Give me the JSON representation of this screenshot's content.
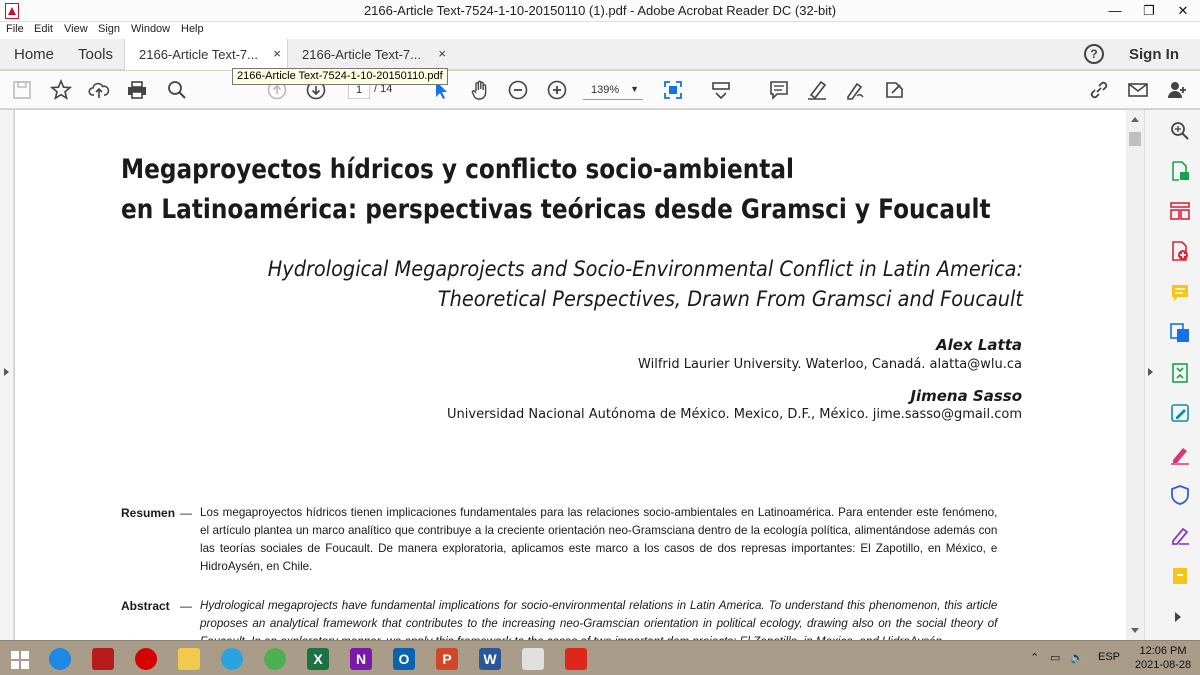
{
  "window": {
    "title": "2166-Article Text-7524-1-10-20150110 (1).pdf - Adobe Acrobat Reader DC (32-bit)",
    "minimize": "—",
    "restore": "❐",
    "close": "✕"
  },
  "menu": [
    "File",
    "Edit",
    "View",
    "Sign",
    "Window",
    "Help"
  ],
  "tabs": {
    "home": "Home",
    "tools": "Tools",
    "docs": [
      {
        "label": "2166-Article Text-7...",
        "close": "×"
      },
      {
        "label": "2166-Article Text-7...",
        "close": "×"
      }
    ],
    "help": "?",
    "sign_in": "Sign In"
  },
  "toolbar": {
    "tooltip": "2166-Article Text-7524-1-10-20150110.pdf",
    "page_current": "1",
    "page_total": "/ 14",
    "zoom": "139%",
    "icons": [
      "save-icon",
      "star-icon",
      "upload-icon",
      "print-icon",
      "search-icon",
      "prev-page-icon",
      "next-page-icon",
      "select-arrow-icon",
      "hand-icon",
      "zoom-out-icon",
      "zoom-in-icon",
      "fit-page-icon",
      "scroll-mode-icon",
      "comment-icon",
      "highlight-icon",
      "sign-icon",
      "share-icon",
      "link-icon",
      "email-icon",
      "add-user-icon"
    ]
  },
  "document": {
    "title_line1": "Megaproyectos hídricos y conflicto socio-ambiental",
    "title_line2": "en Latinoamérica: perspectivas teóricas desde Gramsci y Foucault",
    "subtitle_line1": "Hydrological Megaprojects and Socio-Environmental Conflict in Latin America:",
    "subtitle_line2": "Theoretical Perspectives, Drawn From Gramsci and Foucault",
    "author1": "Alex Latta",
    "affil1": "Wilfrid Laurier University. Waterloo, Canadá. alatta@wlu.ca",
    "author2": "Jimena Sasso",
    "affil2": "Universidad Nacional Autónoma de México. Mexico, D.F., México. jime.sasso@gmail.com",
    "resumen_label": "Resumen",
    "resumen_dash": "—",
    "resumen_text": "Los megaproyectos hídricos tienen implicaciones fundamentales para las relaciones socio-ambientales en Latinoamérica. Para entender este fenómeno, el artículo plantea un marco analítico que contribuye a la creciente orientación neo-Gramsciana dentro de la ecología política, alimentándose además con las teorías sociales de Foucault. De manera exploratoria, aplicamos este marco a los casos de dos represas importantes: El Zapotillo, en México, e HidroAysén, en Chile.",
    "abstract_label": "Abstract",
    "abstract_dash": "—",
    "abstract_text": "Hydrological megaprojects have fundamental implications for socio-environmental relations in Latin America. To understand this phenomenon, this article proposes an analytical framework that contributes to the increasing neo-Gramscian orientation in political ecology, drawing also on the social theory of Foucault. In an exploratory manner, we apply this framework to the cases of two important dam projects: El Zapotillo, in Mexico, and HidroAysén"
  },
  "right_panel": {
    "icons": [
      "search-zoom-icon",
      "export-pdf-icon",
      "organize-pages-icon",
      "create-pdf-icon",
      "comment-tool-icon",
      "combine-files-icon",
      "compress-icon",
      "edit-pdf-icon",
      "fill-sign-icon",
      "protect-icon",
      "sign-pen-icon",
      "more-tools-icon"
    ]
  },
  "taskbar": {
    "apps": [
      {
        "name": "start-icon",
        "color": "#1b1b1b"
      },
      {
        "name": "internet-explorer-icon",
        "color": "#1e88e5"
      },
      {
        "name": "mendeley-icon",
        "color": "#b71c1c"
      },
      {
        "name": "opera-icon",
        "color": "#d50000"
      },
      {
        "name": "file-explorer-icon",
        "color": "#f2c94c"
      },
      {
        "name": "telegram-icon",
        "color": "#2aa3df"
      },
      {
        "name": "chrome-icon",
        "color": "#4caf50"
      },
      {
        "name": "excel-icon",
        "color": "#1e7145",
        "letter": "X"
      },
      {
        "name": "onenote-icon",
        "color": "#7719aa",
        "letter": "N"
      },
      {
        "name": "outlook-icon",
        "color": "#0a64ad",
        "letter": "O"
      },
      {
        "name": "powerpoint-icon",
        "color": "#d24726",
        "letter": "P"
      },
      {
        "name": "word-icon",
        "color": "#2b579a",
        "letter": "W"
      },
      {
        "name": "snipping-tool-icon",
        "color": "#e0e0e0"
      },
      {
        "name": "acrobat-icon",
        "color": "#e0251b"
      }
    ],
    "language": "ESP",
    "time": "12:06 PM",
    "date": "2021-08-28"
  }
}
